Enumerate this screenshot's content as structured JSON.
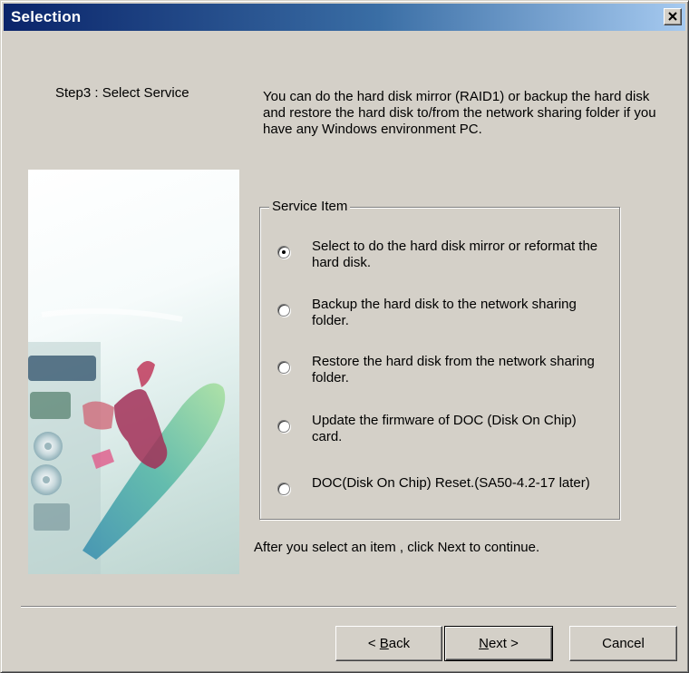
{
  "window": {
    "title": "Selection"
  },
  "step": {
    "label": "Step3 : Select Service"
  },
  "intro": {
    "text": "You can do the hard disk mirror (RAID1) or backup the hard disk and restore the hard disk to/from the network sharing folder if you have any Windows environment PC."
  },
  "service_group": {
    "legend": "Service Item",
    "selected_index": 0,
    "options": [
      {
        "label": "Select to do the hard disk mirror or reformat the hard disk.",
        "checked": true
      },
      {
        "label": "Backup the hard disk to the network sharing folder.",
        "checked": false
      },
      {
        "label": "Restore the hard disk from the network sharing folder.",
        "checked": false
      },
      {
        "label": "Update the firmware of DOC (Disk On Chip) card.",
        "checked": false
      },
      {
        "label": "DOC(Disk On Chip) Reset.(SA50-4.2-17 later)",
        "checked": false
      }
    ]
  },
  "hint": {
    "text": "After you select an item , click Next to continue."
  },
  "buttons": {
    "back_prefix": "< ",
    "back_mnemonic": "B",
    "back_rest": "ack",
    "next_mnemonic": "N",
    "next_rest": "ext >",
    "cancel": "Cancel"
  },
  "icons": {
    "close": "close-icon",
    "radio": "radio-button"
  }
}
